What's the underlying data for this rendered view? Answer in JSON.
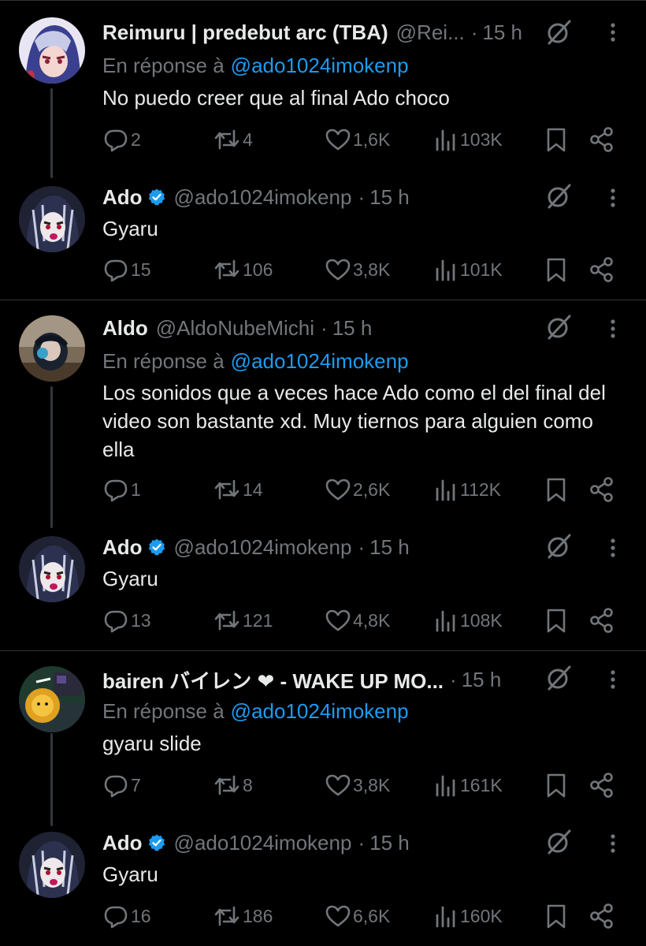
{
  "replying_prefix": "En réponse à",
  "colors": {
    "background": "#000000",
    "text": "#e7e9ea",
    "muted": "#71767b",
    "link": "#1d9bf0",
    "verified": "#1d9bf0",
    "divider": "#2f3336"
  },
  "icons": {
    "reply": "comment-bubble-icon",
    "retweet": "retweet-arrows-icon",
    "like": "heart-icon",
    "views": "bar-chart-icon",
    "bookmark": "bookmark-icon",
    "share": "share-icon",
    "grok": "grok-slash-circle-icon",
    "more": "more-vertical-icon"
  },
  "tweets": [
    {
      "name": "Reimuru | predebut arc (TBA)",
      "handle": "@Rei...",
      "time": "15 h",
      "verified": false,
      "reply_to": "@ado1024imokenp",
      "text": "No puedo creer que al final Ado choco",
      "stats": {
        "replies": "2",
        "retweets": "4",
        "likes": "1,6K",
        "views": "103K"
      }
    },
    {
      "name": "Ado",
      "handle": "@ado1024imokenp",
      "time": "15 h",
      "verified": true,
      "reply_to": "",
      "text": "Gyaru",
      "stats": {
        "replies": "15",
        "retweets": "106",
        "likes": "3,8K",
        "views": "101K"
      }
    },
    {
      "name": "Aldo",
      "handle": "@AldoNubeMichi",
      "time": "15 h",
      "verified": false,
      "reply_to": "@ado1024imokenp",
      "text": "Los sonidos que a veces hace Ado como el del final del video son bastante xd. Muy tiernos para alguien como ella",
      "stats": {
        "replies": "1",
        "retweets": "14",
        "likes": "2,6K",
        "views": "112K"
      }
    },
    {
      "name": "Ado",
      "handle": "@ado1024imokenp",
      "time": "15 h",
      "verified": true,
      "reply_to": "",
      "text": "Gyaru",
      "stats": {
        "replies": "13",
        "retweets": "121",
        "likes": "4,8K",
        "views": "108K"
      }
    },
    {
      "name": "bairen バイレン ❤︎ - WAKE UP MO...",
      "handle": "",
      "time": "15 h",
      "verified": false,
      "reply_to": "@ado1024imokenp",
      "text": "gyaru slide",
      "stats": {
        "replies": "7",
        "retweets": "8",
        "likes": "3,8K",
        "views": "161K"
      }
    },
    {
      "name": "Ado",
      "handle": "@ado1024imokenp",
      "time": "15 h",
      "verified": true,
      "reply_to": "",
      "text": "Gyaru",
      "stats": {
        "replies": "16",
        "retweets": "186",
        "likes": "6,6K",
        "views": "160K"
      }
    }
  ]
}
